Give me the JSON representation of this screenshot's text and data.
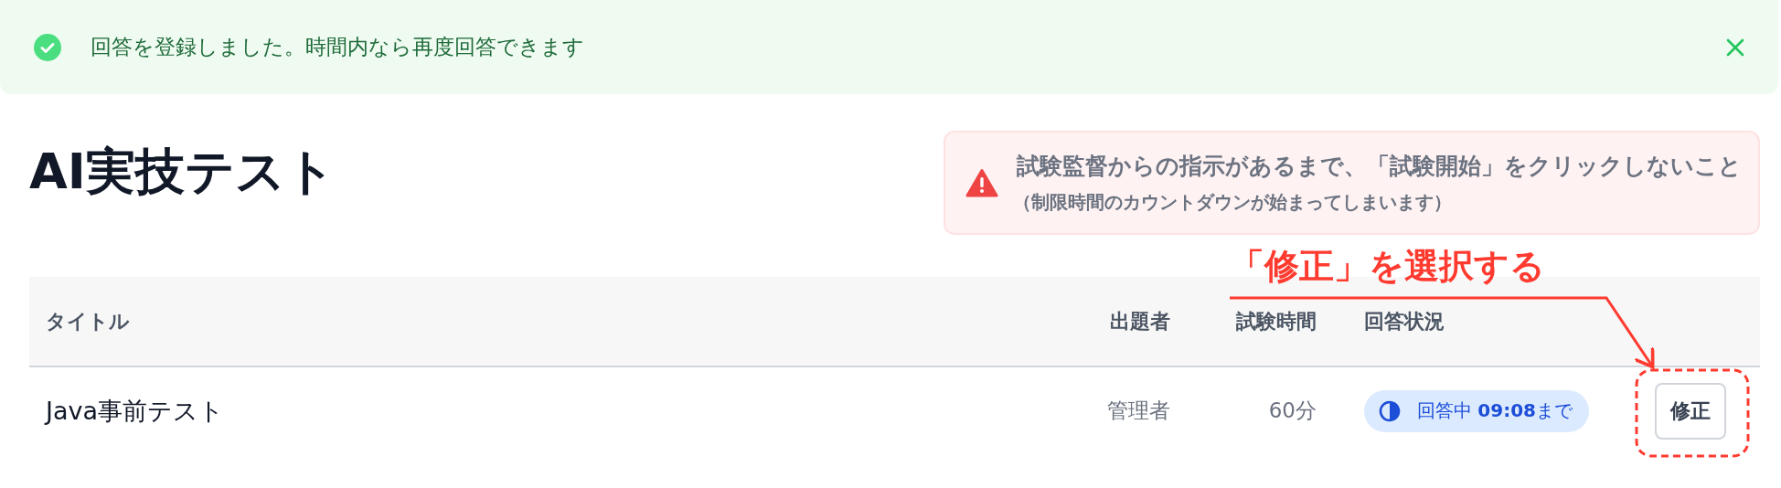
{
  "alert": {
    "kind": "success",
    "message": "回答を登録しました。時間内なら再度回答できます",
    "dismissible": true
  },
  "page_title": "AI実技テスト",
  "warning": {
    "message": "試験監督からの指示があるまで、「試験開始」をクリックしないこと",
    "note": "（制限時間のカウントダウンが始まってしまいます）"
  },
  "table": {
    "columns": [
      "タイトル",
      "出題者",
      "試験時間",
      "回答状況"
    ],
    "rows": [
      {
        "title": "Java事前テスト",
        "author": "管理者",
        "duration": "60分",
        "status": {
          "kind": "in_progress",
          "text": "回答中 **09:08**まで"
        },
        "action": "修正"
      }
    ]
  },
  "annotation": {
    "text": "「修正」を選択する"
  }
}
